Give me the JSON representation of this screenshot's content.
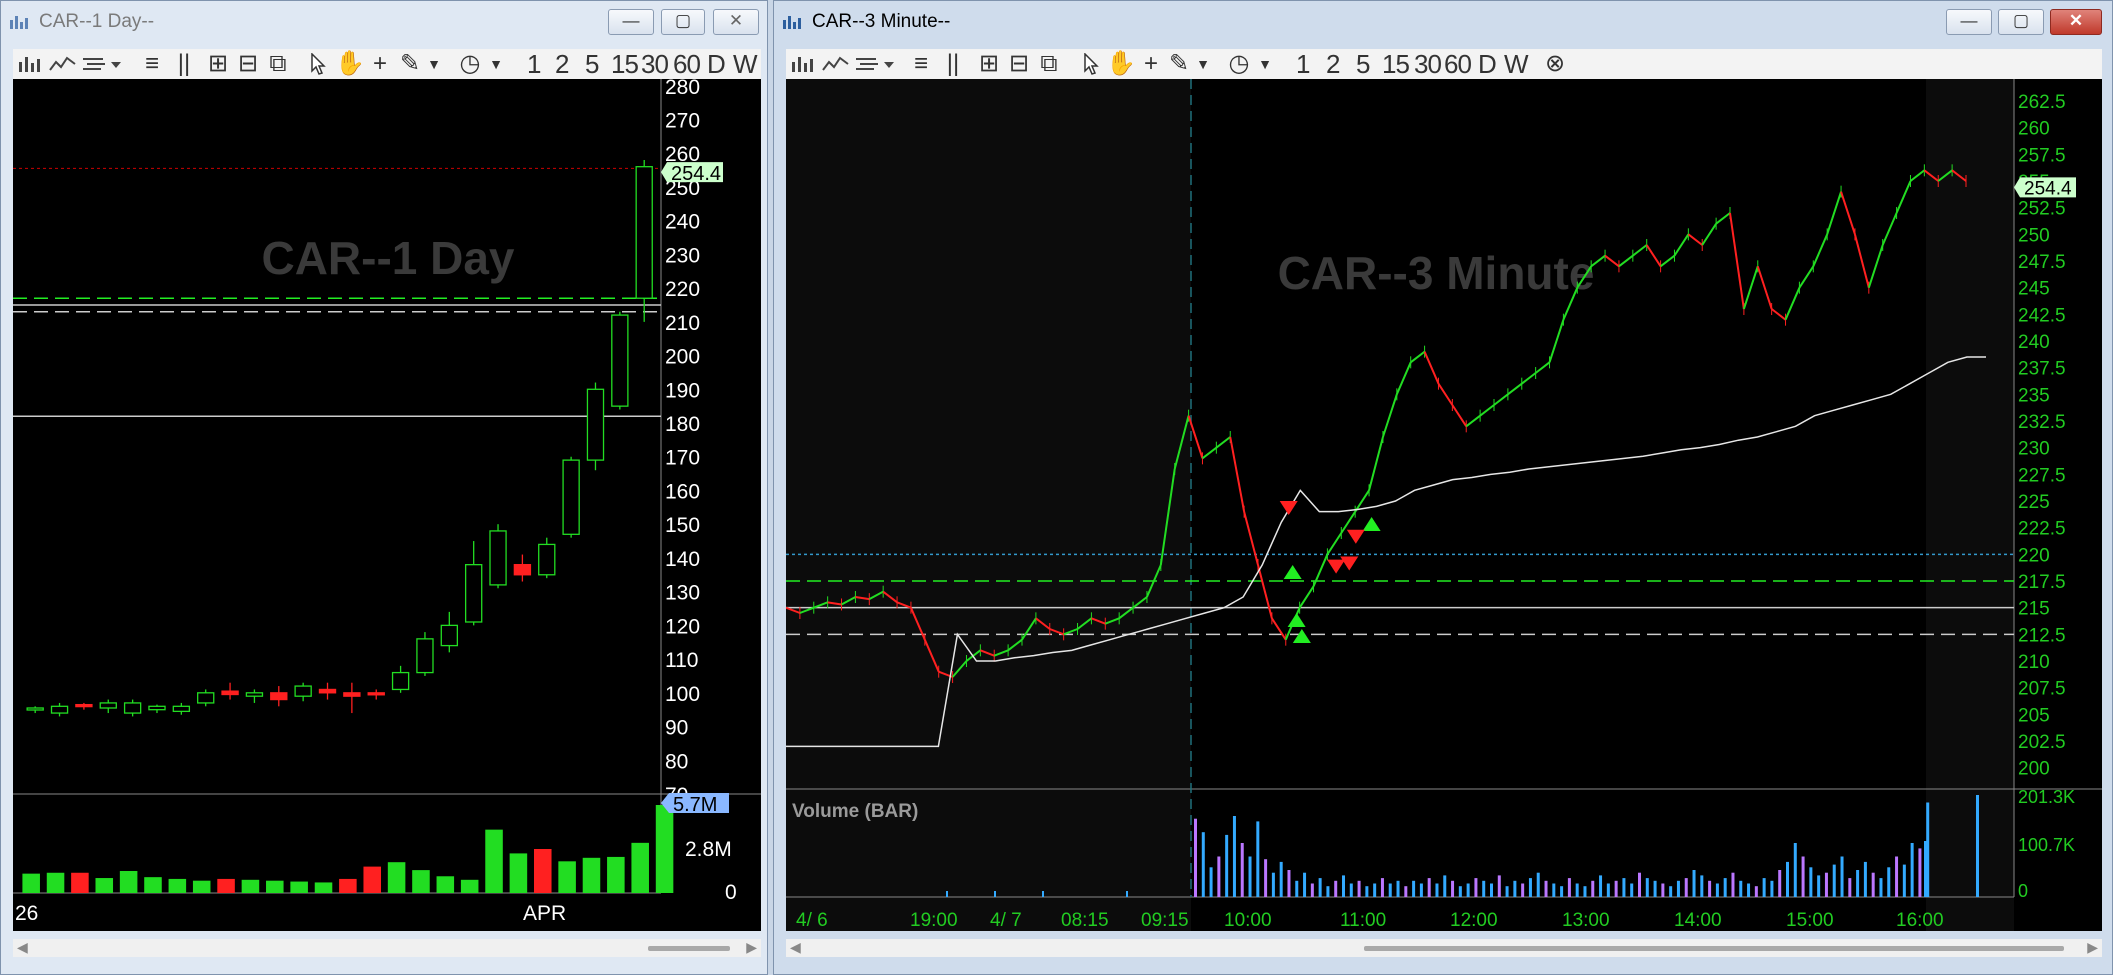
{
  "left_window": {
    "title": "CAR--1 Day--",
    "watermark": "CAR--1 Day",
    "toolbar_intervals": [
      "1",
      "2",
      "5",
      "15",
      "30",
      "60",
      "D",
      "W"
    ],
    "price_label": "254.4",
    "volume_label": "5.7M",
    "date_labels": [
      "26",
      "APR"
    ],
    "colors": {
      "up": "#22dd22",
      "down": "#ff2020",
      "grid_green": "#22ee22",
      "red_line": "#cc0000"
    }
  },
  "right_window": {
    "title": "CAR--3 Minute--",
    "watermark": "CAR--3 Minute",
    "toolbar_intervals": [
      "1",
      "2",
      "5",
      "15",
      "30",
      "60",
      "D",
      "W"
    ],
    "price_label": "254.4",
    "volume_panel_title": "Volume (BAR)",
    "volume_axis": [
      "201.3K",
      "100.7K",
      "0"
    ],
    "time_labels": [
      "4/ 6",
      "19:00",
      "4/ 7",
      "08:15",
      "09:15",
      "10:00",
      "11:00",
      "12:00",
      "13:00",
      "14:00",
      "15:00",
      "16:00"
    ],
    "colors": {
      "axis": "#22cc22",
      "volume_blue": "#33aaff",
      "volume_purple": "#bb77ff",
      "blue_line": "#2a6fd1"
    }
  },
  "chart_data": [
    {
      "type": "bar",
      "title": "CAR--1 Day",
      "xlabel": "",
      "ylabel": "",
      "y_ticks": [
        280,
        270,
        260,
        250,
        240,
        230,
        220,
        210,
        200,
        190,
        180,
        170,
        160,
        150,
        140,
        130,
        120,
        110,
        100,
        90,
        80,
        70
      ],
      "ylim": [
        70,
        282
      ],
      "volume_ticks": [
        "5.7M",
        "2.8M",
        "0"
      ],
      "series": [
        {
          "values": [
            {
              "o": 95,
              "h": 96,
              "l": 94,
              "c": 95.5
            },
            {
              "o": 94,
              "h": 97,
              "l": 93,
              "c": 96
            },
            {
              "o": 96.5,
              "h": 97,
              "l": 95,
              "c": 96
            },
            {
              "o": 95.5,
              "h": 98,
              "l": 94,
              "c": 97
            },
            {
              "o": 94,
              "h": 98,
              "l": 93,
              "c": 97
            },
            {
              "o": 95,
              "h": 96.5,
              "l": 94,
              "c": 96
            },
            {
              "o": 94.5,
              "h": 97,
              "l": 93.5,
              "c": 96
            },
            {
              "o": 97,
              "h": 101,
              "l": 96,
              "c": 100
            },
            {
              "o": 100.5,
              "h": 103,
              "l": 98,
              "c": 99.5
            },
            {
              "o": 99,
              "h": 101,
              "l": 97,
              "c": 100
            },
            {
              "o": 100,
              "h": 102,
              "l": 96,
              "c": 98
            },
            {
              "o": 99,
              "h": 103,
              "l": 97.5,
              "c": 102
            },
            {
              "o": 101,
              "h": 103,
              "l": 98,
              "c": 100
            },
            {
              "o": 100,
              "h": 103,
              "l": 94,
              "c": 99
            },
            {
              "o": 100,
              "h": 101,
              "l": 98,
              "c": 99.5
            },
            {
              "o": 101,
              "h": 108,
              "l": 100,
              "c": 106
            },
            {
              "o": 106,
              "h": 118,
              "l": 105,
              "c": 116
            },
            {
              "o": 114,
              "h": 124,
              "l": 112,
              "c": 120
            },
            {
              "o": 121,
              "h": 145,
              "l": 120,
              "c": 138
            },
            {
              "o": 132,
              "h": 150,
              "l": 131,
              "c": 148
            },
            {
              "o": 138,
              "h": 141,
              "l": 133,
              "c": 135
            },
            {
              "o": 135,
              "h": 146,
              "l": 134,
              "c": 144
            },
            {
              "o": 147,
              "h": 170,
              "l": 146,
              "c": 169
            },
            {
              "o": 169,
              "h": 192,
              "l": 166,
              "c": 190
            },
            {
              "o": 185,
              "h": 213,
              "l": 184,
              "c": 212
            },
            {
              "o": 217,
              "h": 258,
              "l": 210,
              "c": 256
            }
          ]
        }
      ],
      "volume": [
        0.22,
        0.23,
        0.23,
        0.17,
        0.25,
        0.18,
        0.16,
        0.14,
        0.16,
        0.15,
        0.14,
        0.13,
        0.12,
        0.16,
        0.3,
        0.35,
        0.26,
        0.19,
        0.15,
        0.72,
        0.45,
        0.5,
        0.36,
        0.4,
        0.41,
        0.57,
        1.0
      ],
      "volume_up": [
        true,
        true,
        false,
        true,
        true,
        true,
        true,
        true,
        false,
        true,
        true,
        true,
        true,
        false,
        false,
        true,
        true,
        true,
        true,
        true,
        true,
        false,
        true,
        true,
        true,
        true,
        true
      ],
      "hlines": [
        {
          "y": 255.5,
          "style": "dotted",
          "color": "#cc0000"
        },
        {
          "y": 217,
          "style": "dashed",
          "color": "#22ee22"
        },
        {
          "y": 215,
          "style": "solid",
          "color": "#cccccc"
        },
        {
          "y": 213,
          "style": "dashed",
          "color": "#cccccc"
        },
        {
          "y": 182,
          "style": "solid",
          "color": "#cccccc"
        }
      ]
    },
    {
      "type": "line",
      "title": "CAR--3 Minute",
      "xlabel": "",
      "ylabel": "",
      "y_ticks": [
        262.5,
        260,
        257.5,
        255,
        252.5,
        250,
        247.5,
        245,
        242.5,
        240,
        237.5,
        235,
        232.5,
        230,
        227.5,
        225,
        222.5,
        220,
        217.5,
        215,
        212.5,
        210,
        207.5,
        205,
        202.5,
        200
      ],
      "ylim": [
        198,
        264
      ],
      "x_ticks": [
        "4/ 6",
        "19:00",
        "4/ 7",
        "08:15",
        "09:15",
        "10:00",
        "11:00",
        "12:00",
        "13:00",
        "14:00",
        "15:00",
        "16:00"
      ],
      "series": [
        {
          "name": "price",
          "values": [
            215,
            214.5,
            215,
            215.5,
            215.3,
            216,
            215.8,
            216.5,
            215.5,
            215,
            212,
            209,
            208.5,
            210,
            211,
            210.5,
            211,
            212,
            214,
            213,
            212.5,
            213,
            214,
            213.5,
            214,
            215,
            216,
            219,
            228,
            233,
            229,
            230,
            231,
            224,
            219,
            214,
            212,
            215,
            217,
            220,
            222,
            224,
            226,
            231,
            235,
            238,
            239,
            236,
            234,
            232,
            233,
            234,
            235,
            236,
            237,
            238,
            242,
            245,
            247,
            248,
            247,
            248,
            249,
            247,
            248,
            250,
            249,
            251,
            252,
            243,
            247,
            243,
            242,
            245,
            247,
            250,
            254,
            250,
            245,
            249,
            252,
            255,
            256,
            255,
            256,
            255
          ]
        },
        {
          "name": "vwap",
          "values": [
            202,
            202,
            202,
            202,
            202,
            202,
            202,
            202,
            202,
            212.5,
            210,
            210,
            210.3,
            210.5,
            210.8,
            211,
            211.5,
            212,
            212.5,
            213,
            213.5,
            214,
            214.5,
            215,
            216,
            219,
            223,
            226,
            224,
            224,
            224.2,
            224.5,
            225,
            226,
            226.5,
            227,
            227.2,
            227.5,
            227.7,
            228,
            228.2,
            228.4,
            228.6,
            228.8,
            229,
            229.2,
            229.5,
            229.8,
            230,
            230.3,
            230.7,
            231,
            231.5,
            232,
            233,
            233.5,
            234,
            234.5,
            235,
            236,
            237,
            238,
            238.5,
            238.5
          ]
        }
      ],
      "markers_up": [
        [
          219,
          0.385
        ],
        [
          214.5,
          0.388
        ],
        [
          213,
          0.392
        ],
        [
          223.5,
          0.445
        ]
      ],
      "markers_down": [
        [
          225,
          0.382
        ],
        [
          219.5,
          0.418
        ],
        [
          219.8,
          0.428
        ],
        [
          222.3,
          0.433
        ]
      ],
      "hlines": [
        {
          "y": 220,
          "style": "dotted",
          "color": "#3399cc"
        },
        {
          "y": 217.5,
          "style": "dashed",
          "color": "#22ee22"
        },
        {
          "y": 215,
          "style": "solid",
          "color": "#cccccc"
        },
        {
          "y": 212.5,
          "style": "dashed",
          "color": "#cccccc"
        }
      ]
    }
  ]
}
